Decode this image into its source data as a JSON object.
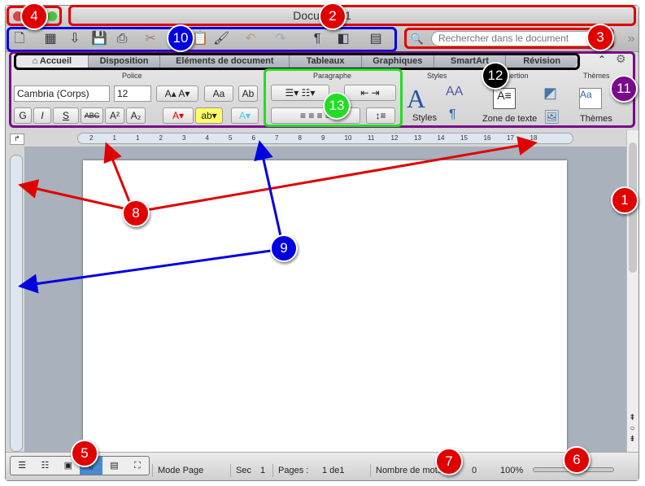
{
  "window": {
    "title": "Document1"
  },
  "toolbar": {
    "icons": [
      "new-document-icon",
      "gallery-icon",
      "open-icon",
      "save-icon",
      "print-icon",
      "cut-icon",
      "paste-icon",
      "format-painter-icon",
      "undo-icon",
      "redo-icon",
      "pilcrow-icon",
      "sidebar-icon",
      "toolbox-icon"
    ]
  },
  "search": {
    "placeholder": "Rechercher dans le document"
  },
  "ribbon": {
    "tabs": [
      {
        "label": "Accueil"
      },
      {
        "label": "Disposition"
      },
      {
        "label": "Eléments de document"
      },
      {
        "label": "Tableaux"
      },
      {
        "label": "Graphiques"
      },
      {
        "label": "SmartArt"
      },
      {
        "label": "Révision"
      }
    ],
    "groups": {
      "police": "Police",
      "paragraphe": "Paragraphe",
      "styles": "Styles",
      "insertion": "Insertion",
      "themes": "Thèmes"
    },
    "font_name": "Cambria (Corps)",
    "font_size": "12",
    "format_buttons": [
      "G",
      "I",
      "S",
      "ABC",
      "A²",
      "A₂"
    ],
    "styles_label": "Styles",
    "textbox_label": "Zone de texte",
    "themes_label": "Thèmes"
  },
  "ruler": {
    "ticks": [
      "2",
      "1",
      "1",
      "2",
      "3",
      "4",
      "5",
      "6",
      "7",
      "8",
      "9",
      "10",
      "11",
      "12",
      "13",
      "14",
      "15",
      "16",
      "17",
      "18"
    ]
  },
  "status": {
    "view_mode": "Mode Page",
    "sec_label": "Sec",
    "sec_value": "1",
    "pages_label": "Pages :",
    "pages_value": "1 de1",
    "words_label": "Nombre de mots",
    "words_value": "0",
    "zoom": "100%"
  },
  "annotations": [
    {
      "n": "1",
      "color": "#e00000"
    },
    {
      "n": "2",
      "color": "#e00000"
    },
    {
      "n": "3",
      "color": "#e00000"
    },
    {
      "n": "4",
      "color": "#e00000"
    },
    {
      "n": "5",
      "color": "#e00000"
    },
    {
      "n": "6",
      "color": "#e00000"
    },
    {
      "n": "7",
      "color": "#e00000"
    },
    {
      "n": "8",
      "color": "#e00000"
    },
    {
      "n": "9",
      "color": "#0000e0"
    },
    {
      "n": "10",
      "color": "#0000e0"
    },
    {
      "n": "11",
      "color": "#7a0a8a"
    },
    {
      "n": "12",
      "color": "#000000"
    },
    {
      "n": "13",
      "color": "#22dd22"
    }
  ]
}
